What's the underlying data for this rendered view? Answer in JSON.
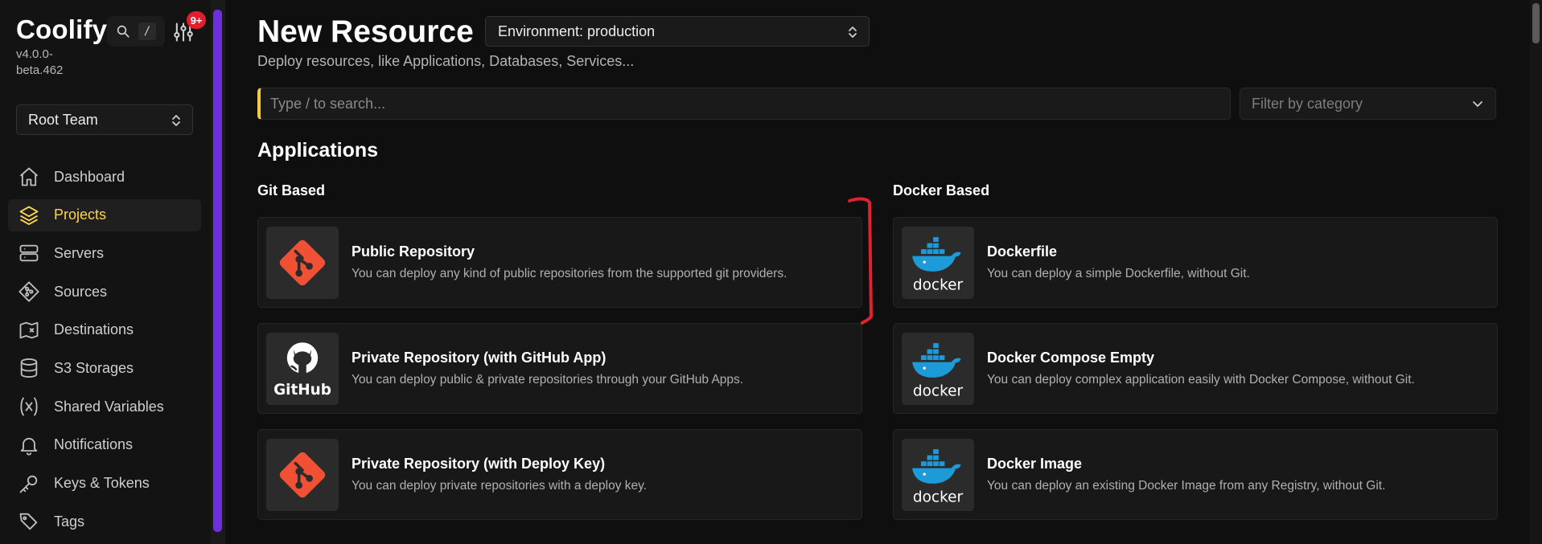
{
  "sidebar": {
    "brand": "Coolify",
    "version": "v4.0.0-beta.462",
    "search_shortcut": "/",
    "notification_badge": "9+",
    "team_select": "Root Team",
    "items": [
      {
        "label": "Dashboard",
        "icon": "home-icon"
      },
      {
        "label": "Projects",
        "icon": "layers-icon",
        "active": true
      },
      {
        "label": "Servers",
        "icon": "server-icon"
      },
      {
        "label": "Sources",
        "icon": "git-icon"
      },
      {
        "label": "Destinations",
        "icon": "map-icon"
      },
      {
        "label": "S3 Storages",
        "icon": "database-icon"
      },
      {
        "label": "Shared Variables",
        "icon": "variable-icon"
      },
      {
        "label": "Notifications",
        "icon": "bell-icon"
      },
      {
        "label": "Keys & Tokens",
        "icon": "key-icon"
      },
      {
        "label": "Tags",
        "icon": "tags-icon"
      }
    ]
  },
  "header": {
    "title": "New Resource",
    "environment": "Environment: production",
    "subtitle": "Deploy resources, like Applications, Databases, Services..."
  },
  "search": {
    "placeholder": "Type / to search...",
    "value": "",
    "filter_placeholder": "Filter by category"
  },
  "applications": {
    "heading": "Applications",
    "git_heading": "Git Based",
    "docker_heading": "Docker Based",
    "git": [
      {
        "title": "Public Repository",
        "description": "You can deploy any kind of public repositories from the supported git providers.",
        "logo": "git-icon"
      },
      {
        "title": "Private Repository (with GitHub App)",
        "description": "You can deploy public & private repositories through your GitHub Apps.",
        "logo": "github-icon",
        "logo_text": "GitHub"
      },
      {
        "title": "Private Repository (with Deploy Key)",
        "description": "You can deploy private repositories with a deploy key.",
        "logo": "git-icon"
      }
    ],
    "docker": [
      {
        "title": "Dockerfile",
        "description": "You can deploy a simple Dockerfile, without Git.",
        "logo": "docker-icon",
        "logo_text": "docker"
      },
      {
        "title": "Docker Compose Empty",
        "description": "You can deploy complex application easily with Docker Compose, without Git.",
        "logo": "docker-icon",
        "logo_text": "docker"
      },
      {
        "title": "Docker Image",
        "description": "You can deploy an existing Docker Image from any Registry, without Git.",
        "logo": "docker-icon",
        "logo_text": "docker"
      }
    ]
  },
  "colors": {
    "accent": "#fcd452",
    "scrollbar": "#6f2fe0",
    "git_orange": "#f05033",
    "docker_blue": "#1d9bd8",
    "annotation_red": "#e0212e",
    "badge_red": "#e11d2e"
  }
}
